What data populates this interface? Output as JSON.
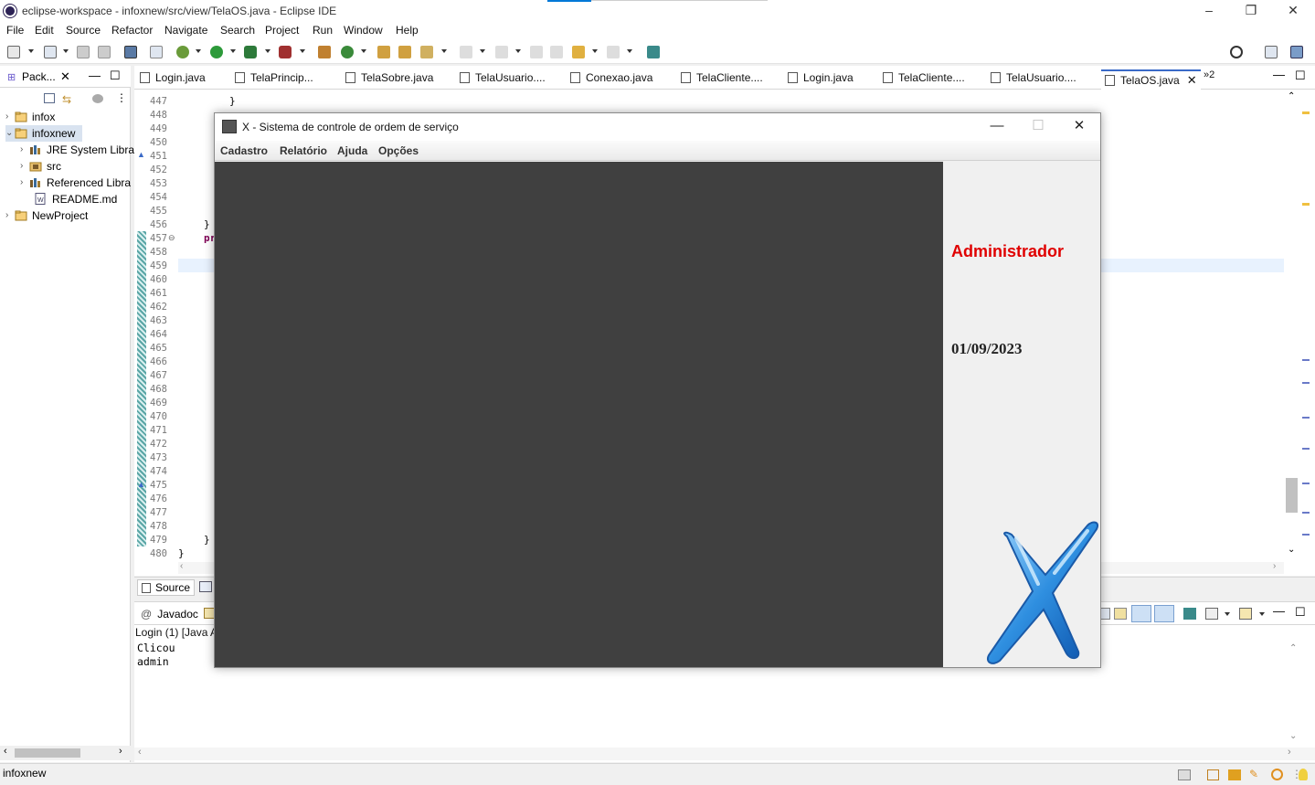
{
  "window": {
    "title": "eclipse-workspace - infoxnew/src/view/TelaOS.java - Eclipse IDE",
    "minimize_glyph": "–",
    "restore_glyph": "❐",
    "close_glyph": "✕"
  },
  "menu": [
    "File",
    "Edit",
    "Source",
    "Refactor",
    "Navigate",
    "Search",
    "Project",
    "Run",
    "Window",
    "Help"
  ],
  "package_explorer": {
    "tab_label": "Pack...",
    "items": [
      {
        "label": "infox"
      },
      {
        "label": "infoxnew"
      },
      {
        "label": "JRE System Libra"
      },
      {
        "label": "src"
      },
      {
        "label": "Referenced Libra"
      },
      {
        "label": "README.md"
      },
      {
        "label": "NewProject"
      }
    ]
  },
  "editor_tabs": [
    "Login.java",
    "TelaPrincip...",
    "TelaSobre.java",
    "TelaUsuario....",
    "Conexao.java",
    "TelaCliente....",
    "Login.java",
    "TelaCliente....",
    "TelaUsuario....",
    "TelaOS.java"
  ],
  "editor_overflow": "»2",
  "editor": {
    "line_numbers": [
      "447",
      "448",
      "449",
      "450",
      "451",
      "452",
      "453",
      "454",
      "455",
      "456",
      "457",
      "458",
      "459",
      "460",
      "461",
      "462",
      "463",
      "464",
      "465",
      "466",
      "467",
      "468",
      "469",
      "470",
      "471",
      "472",
      "473",
      "474",
      "475",
      "476",
      "477",
      "478",
      "479",
      "480"
    ],
    "code_fragments": {
      "l447": "}",
      "l456": "}",
      "l457": "pr",
      "l479": "}",
      "l480": "}"
    }
  },
  "source_tabs": {
    "source": "Source"
  },
  "console": {
    "tab_javadoc": "Javadoc",
    "header": "Login (1) [Java A",
    "lines": [
      "Clicou",
      "admin"
    ]
  },
  "status": {
    "selection": "infoxnew"
  },
  "dialog": {
    "title": "X - Sistema de controle de ordem de serviço",
    "menu": [
      "Cadastro",
      "Relatório",
      "Ajuda",
      "Opções"
    ],
    "user_label": "Administrador",
    "user_color": "#e00000",
    "date_label": "01/09/2023",
    "desktop_color": "#404040",
    "minimize_glyph": "—",
    "maximize_glyph": "☐",
    "close_glyph": "✕"
  }
}
